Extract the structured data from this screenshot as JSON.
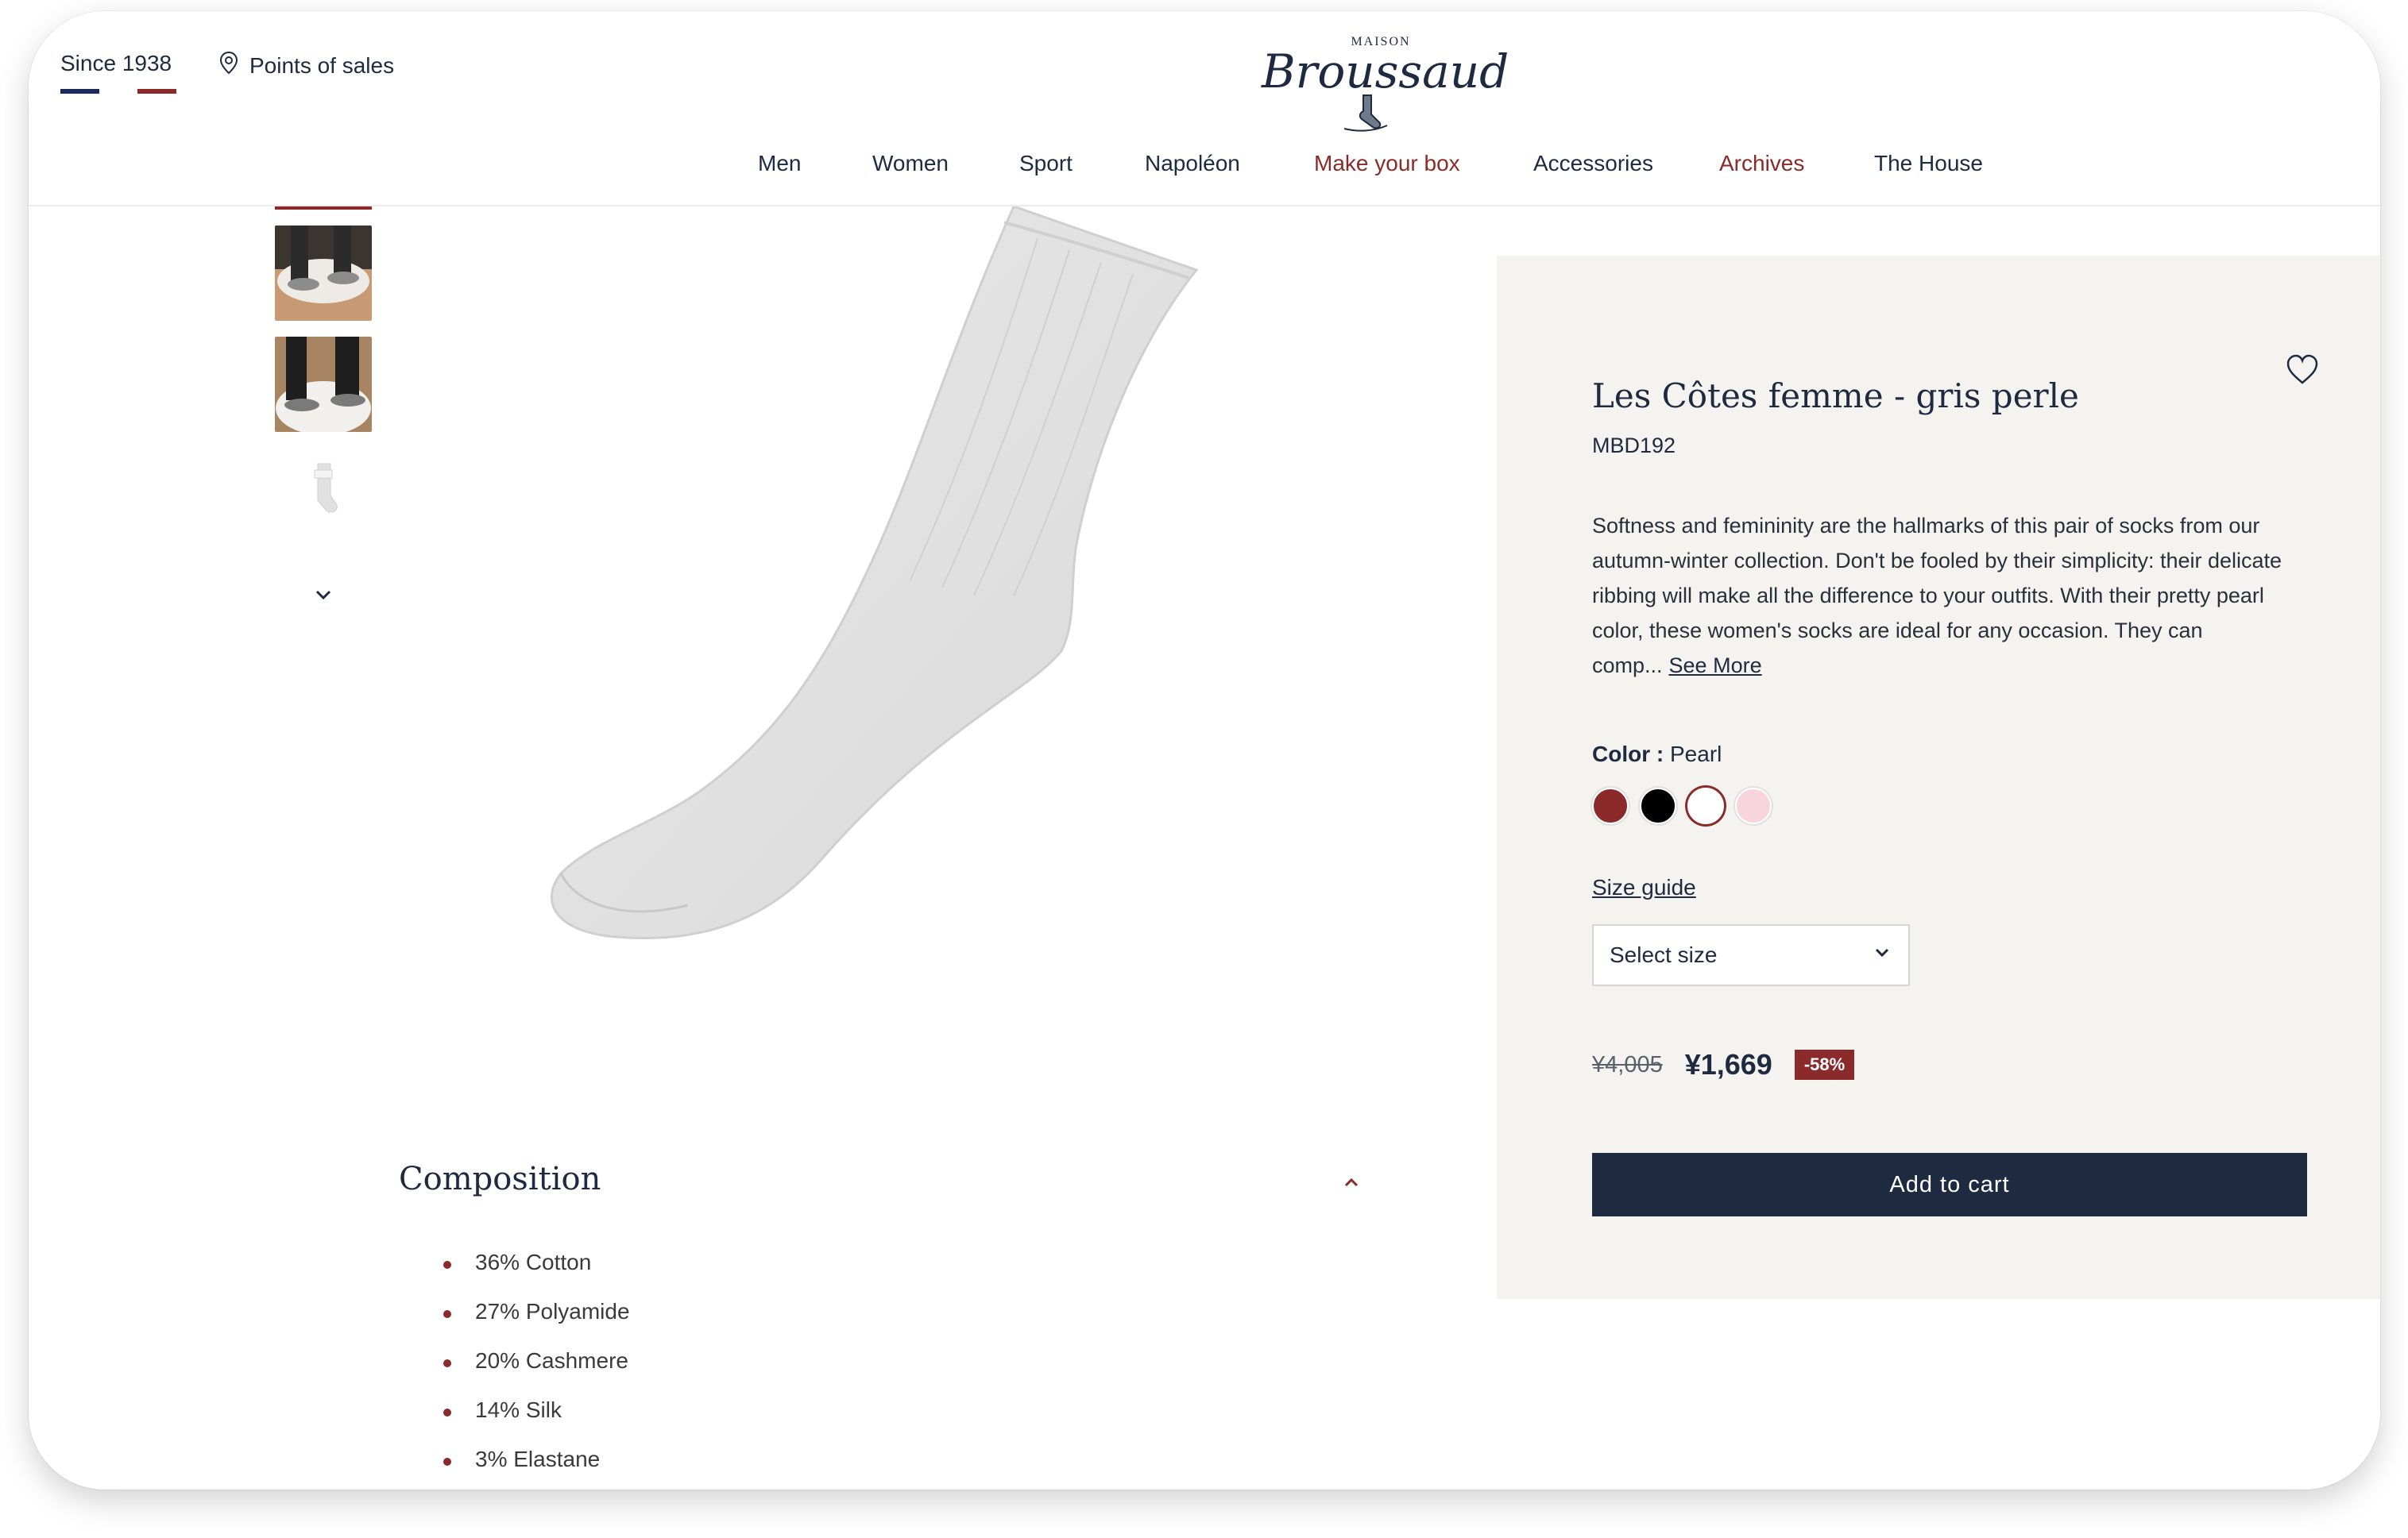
{
  "header": {
    "since": "Since 1938",
    "points_of_sales": "Points of sales",
    "logo_top": "MAISON",
    "logo_brand": "Broussaud",
    "flag_colors": [
      "#1d2a5a",
      "#ffffff",
      "#8a2a2a"
    ]
  },
  "nav": [
    {
      "label": "Men"
    },
    {
      "label": "Women"
    },
    {
      "label": "Sport"
    },
    {
      "label": "Napoléon"
    },
    {
      "label": "Make your box"
    },
    {
      "label": "Accessories"
    },
    {
      "label": "Archives"
    },
    {
      "label": "The House"
    }
  ],
  "product": {
    "title": "Les Côtes femme - gris perle",
    "sku": "MBD192",
    "description": "Softness and femininity are the hallmarks of this pair of socks from our autumn-winter collection. Don't be fooled by their simplicity: their delicate ribbing will make all the difference to your outfits. With their pretty pearl color, these women's socks are ideal for any occasion. They can comp...",
    "see_more": "See More",
    "color_label": "Color :",
    "color_value": "Pearl",
    "swatches": [
      "#8a2a2a",
      "#000000",
      "#ffffff",
      "#f7d4de"
    ],
    "size_guide": "Size guide",
    "size_placeholder": "Select size",
    "old_price": "¥4,005",
    "new_price": "¥1,669",
    "discount": "-58%",
    "add_to_cart": "Add to cart"
  },
  "composition": {
    "title": "Composition",
    "items": [
      "36% Cotton",
      "27% Polyamide",
      "20% Cashmere",
      "14% Silk",
      "3% Elastane"
    ]
  },
  "colors": {
    "navy": "#1d2a3f",
    "accent": "#8a2a2a",
    "panel_bg": "#f4f3f0"
  }
}
